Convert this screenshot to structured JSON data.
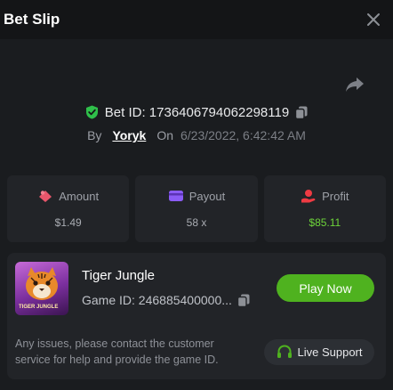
{
  "header": {
    "title": "Bet Slip"
  },
  "bet": {
    "id_text": "Bet ID: 1736406794062298119",
    "by_label": "By",
    "username": "Yoryk",
    "on_label": "On",
    "datetime": "6/23/2022, 6:42:42 AM"
  },
  "stats": {
    "amount": {
      "label": "Amount",
      "value": "$1.49"
    },
    "payout": {
      "label": "Payout",
      "value": "58 x"
    },
    "profit": {
      "label": "Profit",
      "value": "$85.11"
    }
  },
  "game": {
    "name": "Tiger Jungle",
    "thumb_text": "TIGER JUNGLE",
    "id_text": "Game ID: 246885400000...",
    "play_label": "Play Now"
  },
  "support": {
    "notice": "Any issues, please contact the customer service for help and provide the game ID.",
    "button_label": "Live Support"
  },
  "colors": {
    "background": "#1a1c1f",
    "header": "#141517",
    "card": "#222428",
    "accent_green": "#4fb21f",
    "profit_green": "#6dd33a",
    "shield_green": "#2fbf4a",
    "amount_icon": "#e9566b",
    "payout_icon": "#8b5cf6",
    "profit_icon": "#ee3b43"
  },
  "icons": [
    "close-icon",
    "share-icon",
    "shield-check-icon",
    "copy-icon",
    "amount-icon",
    "payout-icon",
    "profit-icon",
    "headset-icon"
  ]
}
